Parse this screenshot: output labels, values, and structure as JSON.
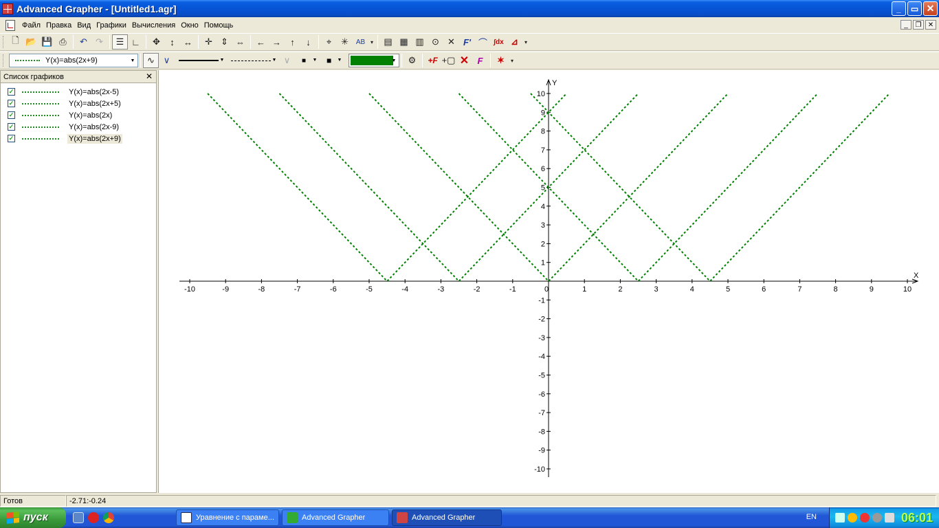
{
  "window": {
    "title": "Advanced Grapher - [Untitled1.agr]",
    "buttons": {
      "minimize": "_",
      "maximize": "▭",
      "close": "✕"
    }
  },
  "menu": [
    "Файл",
    "Правка",
    "Вид",
    "Графики",
    "Вычисления",
    "Окно",
    "Помощь"
  ],
  "toolbar2": {
    "selected_function": "Y(x)=abs(2x+9)",
    "line_color": "#008000"
  },
  "graph_list": {
    "title": "Список графиков",
    "items": [
      {
        "label": "Y(x)=abs(2x-5)",
        "checked": true
      },
      {
        "label": "Y(x)=abs(2x+5)",
        "checked": true
      },
      {
        "label": "Y(x)=abs(2x)",
        "checked": true
      },
      {
        "label": "Y(x)=abs(2x-9)",
        "checked": true
      },
      {
        "label": "Y(x)=abs(2x+9)",
        "checked": true,
        "selected": true
      }
    ]
  },
  "chart_data": {
    "type": "line",
    "xlabel": "X",
    "ylabel": "Y",
    "xlim": [
      -10,
      10
    ],
    "ylim": [
      -10,
      10
    ],
    "x_ticks": [
      "-10",
      "-9",
      "-8",
      "-7",
      "-6",
      "-5",
      "-4",
      "-3",
      "-2",
      "-1",
      "0",
      "1",
      "2",
      "3",
      "4",
      "5",
      "6",
      "7",
      "8",
      "9",
      "10"
    ],
    "y_ticks": [
      "10",
      "9",
      "8",
      "7",
      "6",
      "5",
      "4",
      "3",
      "2",
      "1",
      "-1",
      "-2",
      "-3",
      "-4",
      "-5",
      "-6",
      "-7",
      "-8",
      "-9",
      "-10"
    ],
    "grid": false,
    "line_color": "#008000",
    "line_style": "dotted",
    "series": [
      {
        "name": "Y(x)=abs(2x-5)",
        "formula": "abs(2x-5)",
        "x": [
          -2.5,
          2.5,
          7.5
        ],
        "y": [
          10,
          0,
          10
        ]
      },
      {
        "name": "Y(x)=abs(2x+5)",
        "formula": "abs(2x+5)",
        "x": [
          -7.5,
          -2.5,
          2.5
        ],
        "y": [
          10,
          0,
          10
        ]
      },
      {
        "name": "Y(x)=abs(2x)",
        "formula": "abs(2x)",
        "x": [
          -5,
          0,
          5
        ],
        "y": [
          10,
          0,
          10
        ]
      },
      {
        "name": "Y(x)=abs(2x-9)",
        "formula": "abs(2x-9)",
        "x": [
          -0.5,
          4.5,
          9.5
        ],
        "y": [
          10,
          0,
          10
        ]
      },
      {
        "name": "Y(x)=abs(2x+9)",
        "formula": "abs(2x+9)",
        "x": [
          -9.5,
          -4.5,
          0.5
        ],
        "y": [
          10,
          0,
          10
        ]
      }
    ]
  },
  "status": {
    "state": "Готов",
    "coords": "-2.71:-0.24"
  },
  "taskbar": {
    "start": "пуск",
    "tasks": [
      {
        "label": "Уравнение с параме...",
        "active": false
      },
      {
        "label": "Advanced Grapher",
        "active": false
      },
      {
        "label": "Advanced Grapher",
        "active": true
      }
    ],
    "lang": "EN",
    "clock": "06:01"
  }
}
